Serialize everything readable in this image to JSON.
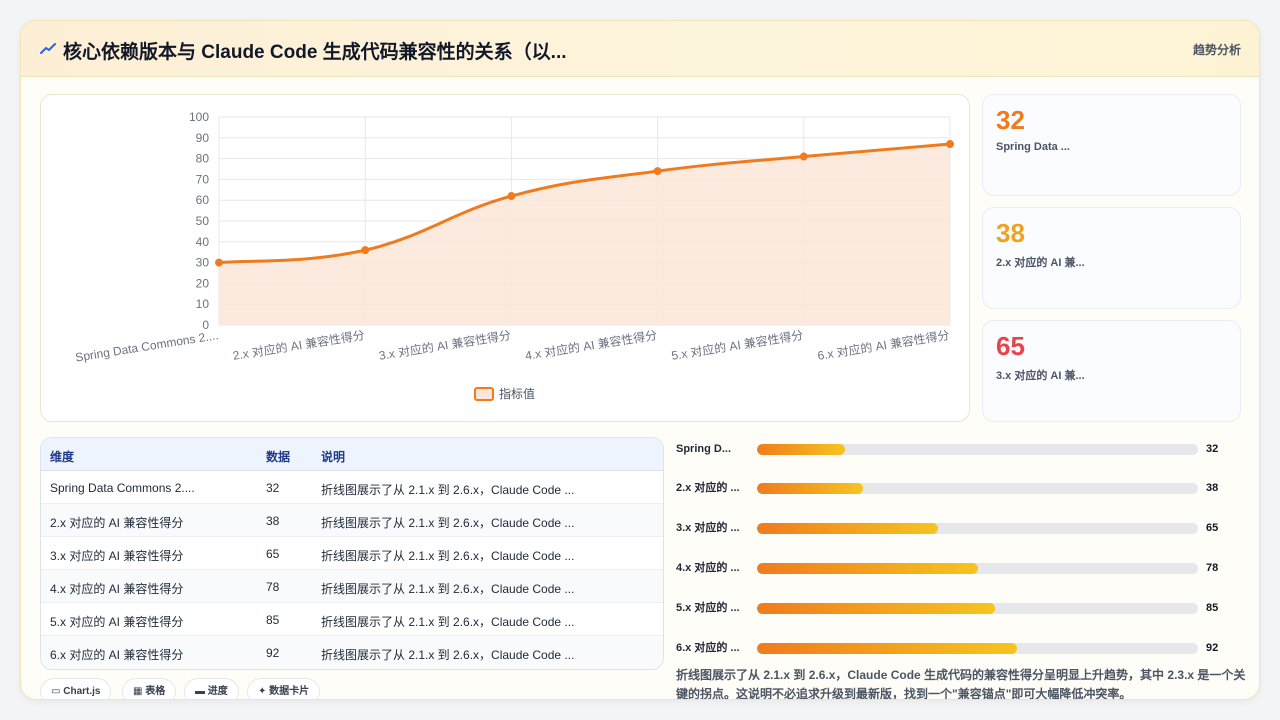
{
  "header": {
    "icon": "trend-line-icon",
    "title": "核心依赖版本与 Claude Code 生成代码兼容性的关系（以...",
    "action_label": "趋势分析"
  },
  "chart_data": {
    "type": "area",
    "categories": [
      "Spring Data Commons 2....",
      "2.x 对应的 AI 兼容性得分",
      "3.x 对应的 AI 兼容性得分",
      "4.x 对应的 AI 兼容性得分",
      "5.x 对应的 AI 兼容性得分",
      "6.x 对应的 AI 兼容性得分"
    ],
    "series": [
      {
        "name": "指标值",
        "values": [
          30,
          36,
          62,
          74,
          81,
          87
        ]
      }
    ],
    "ylim": [
      0,
      100
    ],
    "yticks": [
      "100",
      "90",
      "80",
      "70",
      "60",
      "50",
      "40",
      "30",
      "20",
      "10",
      "0"
    ],
    "grid": true,
    "legend_position": "bottom",
    "colors": {
      "line": "#f07b1e",
      "fill": "#fde6d8"
    }
  },
  "stats": [
    {
      "value": "32",
      "label": "Spring Data ...",
      "color": "#f07b1e"
    },
    {
      "value": "38",
      "label": "2.x 对应的 AI 兼...",
      "color": "#f0a21e"
    },
    {
      "value": "65",
      "label": "3.x 对应的 AI 兼...",
      "color": "#e8434b"
    }
  ],
  "table": {
    "headers": [
      "维度",
      "数据",
      "说明"
    ],
    "rows": [
      [
        "Spring Data Commons 2....",
        "32",
        "折线图展示了从 2.1.x 到 2.6.x，Claude Code ..."
      ],
      [
        "2.x 对应的 AI 兼容性得分",
        "38",
        "折线图展示了从 2.1.x 到 2.6.x，Claude Code ..."
      ],
      [
        "3.x 对应的 AI 兼容性得分",
        "65",
        "折线图展示了从 2.1.x 到 2.6.x，Claude Code ..."
      ],
      [
        "4.x 对应的 AI 兼容性得分",
        "78",
        "折线图展示了从 2.1.x 到 2.6.x，Claude Code ..."
      ],
      [
        "5.x 对应的 AI 兼容性得分",
        "85",
        "折线图展示了从 2.1.x 到 2.6.x，Claude Code ..."
      ],
      [
        "6.x 对应的 AI 兼容性得分",
        "92",
        "折线图展示了从 2.1.x 到 2.6.x，Claude Code ..."
      ]
    ]
  },
  "progress": [
    {
      "label": "Spring D...",
      "value": "32",
      "fraction": 0.2
    },
    {
      "label": "2.x 对应的 ...",
      "value": "38",
      "fraction": 0.24
    },
    {
      "label": "3.x 对应的 ...",
      "value": "65",
      "fraction": 0.41
    },
    {
      "label": "4.x 对应的 ...",
      "value": "78",
      "fraction": 0.5
    },
    {
      "label": "5.x 对应的 ...",
      "value": "85",
      "fraction": 0.54
    },
    {
      "label": "6.x 对应的 ...",
      "value": "92",
      "fraction": 0.59
    }
  ],
  "summary": "折线图展示了从 2.1.x 到 2.6.x，Claude Code 生成代码的兼容性得分呈明显上升趋势，其中 2.3.x 是一个关键的拐点。这说明不必追求升级到最新版，找到一个\"兼容锚点\"即可大幅降低冲突率。",
  "tags": [
    {
      "icon": "chart-icon",
      "glyph": "▭",
      "label": "Chart.js"
    },
    {
      "icon": "table-icon",
      "glyph": "▦",
      "label": "表格"
    },
    {
      "icon": "progress-icon",
      "glyph": "▬",
      "label": "进度"
    },
    {
      "icon": "sparkle-icon",
      "glyph": "✦",
      "label": "数据卡片"
    }
  ]
}
